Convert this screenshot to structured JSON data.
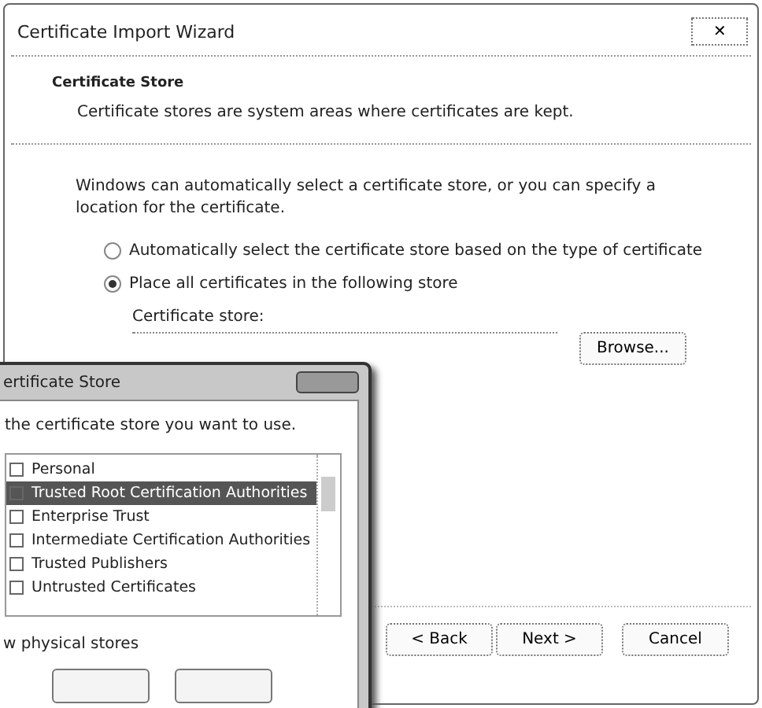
{
  "window": {
    "title": "Certificate Import Wizard",
    "close": "✕"
  },
  "header": {
    "title": "Certificate Store",
    "subtitle": "Certificate stores are system areas where certificates are kept."
  },
  "intro": "Windows can automatically select a certificate store, or you can specify a location for the certificate.",
  "options": [
    {
      "label": "Automatically select the certificate store based on the type of certificate",
      "selected": false
    },
    {
      "label": "Place all certificates in the following store",
      "selected": true
    }
  ],
  "store_label": "Certificate store:",
  "browse": "Browse...",
  "buttons": [
    "< Back",
    "Next >",
    "Cancel"
  ],
  "dialog": {
    "title": "ertificate Store",
    "prompt": "the certificate store you want to use.",
    "items": [
      {
        "label": "Personal",
        "selected": false
      },
      {
        "label": "Trusted Root Certification Authorities",
        "selected": true
      },
      {
        "label": "Enterprise Trust",
        "selected": false
      },
      {
        "label": "Intermediate Certification Authorities",
        "selected": false
      },
      {
        "label": "Trusted Publishers",
        "selected": false
      },
      {
        "label": "Untrusted Certificates",
        "selected": false
      }
    ],
    "show_physical": {
      "label": "w physical stores"
    }
  }
}
